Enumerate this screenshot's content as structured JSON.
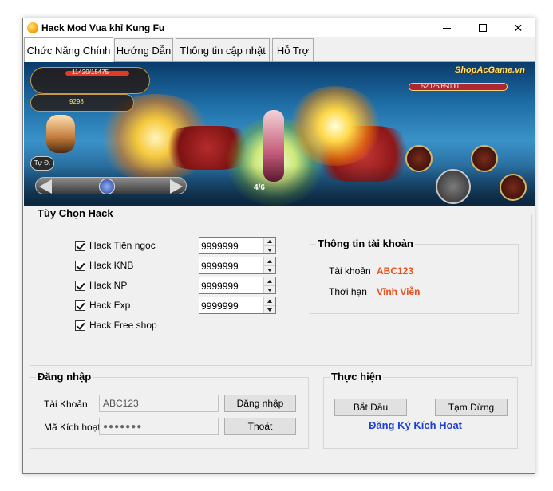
{
  "window": {
    "title": "Hack Mod Vua khỉ Kung Fu",
    "controls": {
      "minimize": "minimize",
      "maximize": "maximize",
      "close": "close"
    }
  },
  "tabs": [
    {
      "label": "Chức Năng Chính",
      "active": true
    },
    {
      "label": "Hướng Dẫn",
      "active": false
    },
    {
      "label": "Thông tin cập nhật",
      "active": false
    },
    {
      "label": "Hỗ Trợ",
      "active": false
    }
  ],
  "banner": {
    "hp_text": "11420/15475",
    "enemy_hp_text": "52026/65000",
    "watermark": "ShopAcGame.vn",
    "wave_counter": "4/6",
    "mode_button": "Tự Đ.",
    "coin_text": "9298"
  },
  "hack_options": {
    "title": "Tùy Chọn Hack",
    "items": [
      {
        "label": "Hack Tiên ngọc",
        "checked": true,
        "value": "9999999"
      },
      {
        "label": "Hack KNB",
        "checked": true,
        "value": "9999999"
      },
      {
        "label": "Hack NP",
        "checked": true,
        "value": "9999999"
      },
      {
        "label": "Hack Exp",
        "checked": true,
        "value": "9999999"
      },
      {
        "label": "Hack Free shop",
        "checked": true
      }
    ]
  },
  "account_info": {
    "title": "Thông tin tài khoản",
    "account_label": "Tài khoản",
    "account_value": "ABC123",
    "duration_label": "Thời hạn",
    "duration_value": "Vĩnh Viễn"
  },
  "login": {
    "title": "Đăng nhập",
    "account_label": "Tài Khoản",
    "account_value": "ABC123",
    "code_label": "Mã Kích hoạt",
    "code_value": "●●●●●●●",
    "login_button": "Đăng nhập",
    "exit_button": "Thoát"
  },
  "execute": {
    "title": "Thực hiện",
    "start_button": "Bắt Đầu",
    "pause_button": "Tạm Dừng",
    "register_link": "Đăng Ký Kích Hoạt"
  },
  "colors": {
    "accent_value": "#e8501e",
    "link": "#1c3fd6",
    "window_bg": "#f0f0f0"
  }
}
